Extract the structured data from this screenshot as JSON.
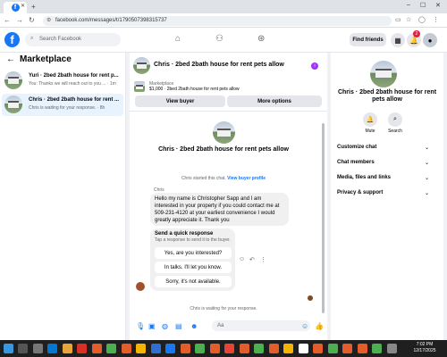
{
  "browser": {
    "tab_icon": "f",
    "url": "facebook.com/messages/t/1790507398315737"
  },
  "header": {
    "logo": "f",
    "search_placeholder": "Search Facebook",
    "find_friends": "Find friends",
    "notification_count": "2"
  },
  "sidebar": {
    "title": "Marketplace",
    "conversations": [
      {
        "name": "Yuri · 2bed 2bath house for rent p...",
        "preview": "You: Thanks we will reach out to you ... · 1m"
      },
      {
        "name": "Chris · 2bed 2bath house for rent ...",
        "preview": "Chris is waiting for your response. · 8h"
      }
    ]
  },
  "chat": {
    "title": "Chris · 2bed 2bath house for rent pets allow",
    "marketplace_label": "Marketplace",
    "listing": "$1,000 · 2bed 2bath house for rent pets allow",
    "view_buyer": "View buyer",
    "more_options": "More options",
    "center_name": "Chris · 2bed 2bath house for rent pets allow",
    "started_text": "Chris started this chat.",
    "view_profile": "View buyer profile",
    "sender": "Chris",
    "message": "Hello my name is Christopher Sapp and I am interested in your property if you could contact me at 509-231-4120 at your earliest convenience I would greatly appreciate it. Thank you",
    "quick_title": "Send a quick response",
    "quick_sub": "Tap a response to send it to the buyer.",
    "quick_responses": [
      "Yes, are you interested?",
      "In talks. I'll let you know.",
      "Sorry, it's not available."
    ],
    "waiting": "Chris is waiting for your response.",
    "composer_placeholder": "Aa"
  },
  "details": {
    "name": "Chris · 2bed 2bath house for rent pets allow",
    "mute": "Mute",
    "search": "Search",
    "menu": [
      "Customize chat",
      "Chat members",
      "Media, files and links",
      "Privacy & support"
    ]
  },
  "taskbar": {
    "time": "7:02 PM",
    "date": "12/17/2025"
  }
}
